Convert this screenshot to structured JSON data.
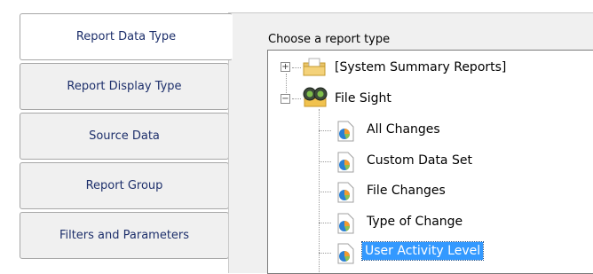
{
  "tabs": [
    {
      "label": "Report Data Type",
      "active": true
    },
    {
      "label": "Report Display Type",
      "active": false
    },
    {
      "label": "Source Data",
      "active": false
    },
    {
      "label": "Report Group",
      "active": false
    },
    {
      "label": "Filters and Parameters",
      "active": false
    }
  ],
  "main": {
    "choose_label": "Choose a report type",
    "tree": {
      "groups": [
        {
          "label": "[System Summary Reports]",
          "expanded": false,
          "icon": "folder-icon"
        },
        {
          "label": "File Sight",
          "expanded": true,
          "icon": "binoculars-icon"
        }
      ],
      "items": [
        {
          "label": "All Changes",
          "icon": "report-pie-icon",
          "selected": false
        },
        {
          "label": "Custom Data Set",
          "icon": "report-pie-icon",
          "selected": false
        },
        {
          "label": "File Changes",
          "icon": "report-pie-icon",
          "selected": false
        },
        {
          "label": "Type of Change",
          "icon": "report-pie-icon",
          "selected": false
        },
        {
          "label": "User Activity Level",
          "icon": "report-pie-icon",
          "selected": true
        }
      ],
      "expand_symbols": {
        "collapsed": "+",
        "expanded": "−"
      }
    }
  },
  "colors": {
    "selection": "#3399ff",
    "tab_text": "#1d2f6b",
    "panel_bg": "#f0f0f0"
  }
}
